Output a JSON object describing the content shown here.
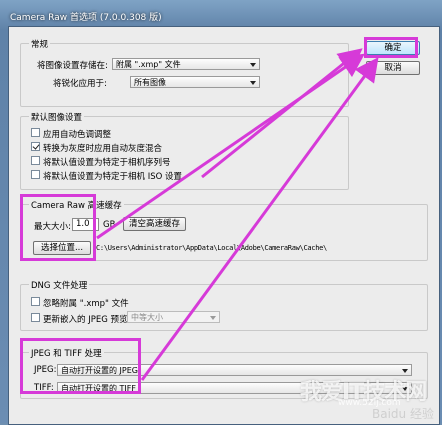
{
  "window": {
    "title": "Camera Raw 首选项 (7.0.0.308 版)"
  },
  "general": {
    "group_label": "常规",
    "save_settings_label": "将图像设置存储在:",
    "save_settings_value": "附属 \".xmp\" 文件",
    "apply_sharpening_label": "将锐化应用于:",
    "apply_sharpening_value": "所有图像"
  },
  "buttons": {
    "ok": "确定",
    "cancel": "取消"
  },
  "default_image": {
    "group_label": "默认图像设置",
    "options": [
      {
        "label": "应用自动色调调整",
        "checked": false
      },
      {
        "label": "转换为灰度时应用自动灰度混合",
        "checked": true
      },
      {
        "label": "将默认值设置为特定于相机序列号",
        "checked": false
      },
      {
        "label": "将默认值设置为特定于相机 ISO 设置",
        "checked": false
      }
    ]
  },
  "cache": {
    "group_label": "Camera Raw 高速缓存",
    "max_size_label": "最大大小:",
    "max_size_value": "1.0",
    "unit": "GB",
    "purge_button": "清空高速缓存",
    "location_button": "选择位置...",
    "path": "C:\\Users\\Administrator\\AppData\\Local\\Adobe\\CameraRaw\\Cache\\"
  },
  "dng": {
    "group_label": "DNG 文件处理",
    "ignore_xmp_label": "忽略附属 \".xmp\" 文件",
    "update_previews_label": "更新嵌入的 JPEG 预览:",
    "preview_size_value": "中等大小"
  },
  "jpeg_tiff": {
    "group_label": "JPEG 和 TIFF 处理",
    "jpeg_label": "JPEG:",
    "jpeg_value": "自动打开设置的 JPEG",
    "tiff_label": "TIFF:",
    "tiff_value": "自动打开设置的 TIFF"
  },
  "watermark": {
    "brand": "我爱IT技术网",
    "url": "www.52ij.com",
    "baidu": "Baidu 经验"
  },
  "colors": {
    "highlight": "#d63ad8",
    "default_button_border": "#3c7fb1"
  }
}
